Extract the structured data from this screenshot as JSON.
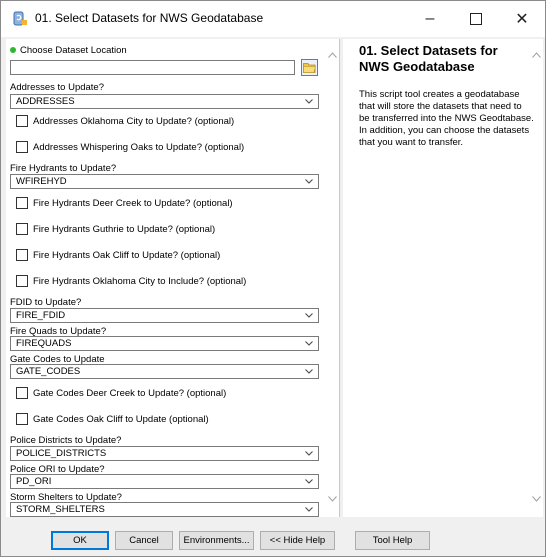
{
  "window": {
    "title": "01. Select Datasets for NWS Geodatabase",
    "minimize": "–",
    "close": "✕"
  },
  "form": {
    "dataset_location_label": "Choose Dataset Location",
    "dataset_location_value": "",
    "addresses_label": "Addresses to Update?",
    "addresses_value": "ADDRESSES",
    "chk_addresses_okc": "Addresses Oklahoma City to Update? (optional)",
    "chk_addresses_whisper": "Addresses Whispering Oaks to Update? (optional)",
    "hydrants_label": "Fire Hydrants to Update?",
    "hydrants_value": "WFIREHYD",
    "chk_hyd_deercreek": "Fire Hydrants Deer Creek to Update? (optional)",
    "chk_hyd_guthrie": "Fire Hydrants Guthrie to Update? (optional)",
    "chk_hyd_oakcliff": "Fire Hydrants Oak Cliff to Update? (optional)",
    "chk_hyd_okc": "Fire Hydrants Oklahoma City to Include? (optional)",
    "fdid_label": "FDID to Update?",
    "fdid_value": "FIRE_FDID",
    "quads_label": "Fire Quads to Update?",
    "quads_value": "FIREQUADS",
    "gate_label": "Gate Codes to Update",
    "gate_value": "GATE_CODES",
    "chk_gate_deercreek": "Gate Codes Deer Creek to Update? (optional)",
    "chk_gate_oakcliff": "Gate Codes Oak Cliff to Update (optional)",
    "police_label": "Police Districts to Update?",
    "police_value": "POLICE_DISTRICTS",
    "ori_label": "Police ORI to Update?",
    "ori_value": "PD_ORI",
    "storm_label": "Storm Shelters to Update?",
    "storm_value": "STORM_SHELTERS"
  },
  "help": {
    "title": "01. Select Datasets for NWS Geodatabase",
    "body": "This script tool creates a geodatabase that will store the datasets that need to be transferred into the NWS Geodtabase. In addition, you can choose the datasets that you want to transfer."
  },
  "buttons": {
    "ok": "OK",
    "cancel": "Cancel",
    "environments": "Environments...",
    "hide_help": "<< Hide Help",
    "tool_help": "Tool Help"
  }
}
